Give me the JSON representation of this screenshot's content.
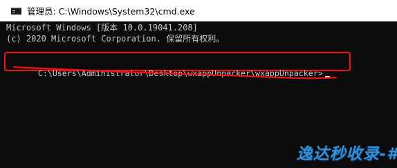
{
  "window": {
    "title": "管理员: C:\\Windows\\System32\\cmd.exe",
    "icon": "cmd-console-icon"
  },
  "console": {
    "line1": "Microsoft Windows [版本 10.0.19041.208]",
    "line2": "(c) 2020 Microsoft Corporation. 保留所有权利。",
    "prompt": "C:\\Users\\Administrator\\Desktop\\wxappUnpacker\\wxappUnpacker>",
    "text_color": "#cccccc",
    "background": "#0c0c0c"
  },
  "annotation": {
    "color": "#ef1212"
  },
  "watermark": {
    "text": "逸达秒收录-#",
    "color": "#2f8fd8"
  }
}
